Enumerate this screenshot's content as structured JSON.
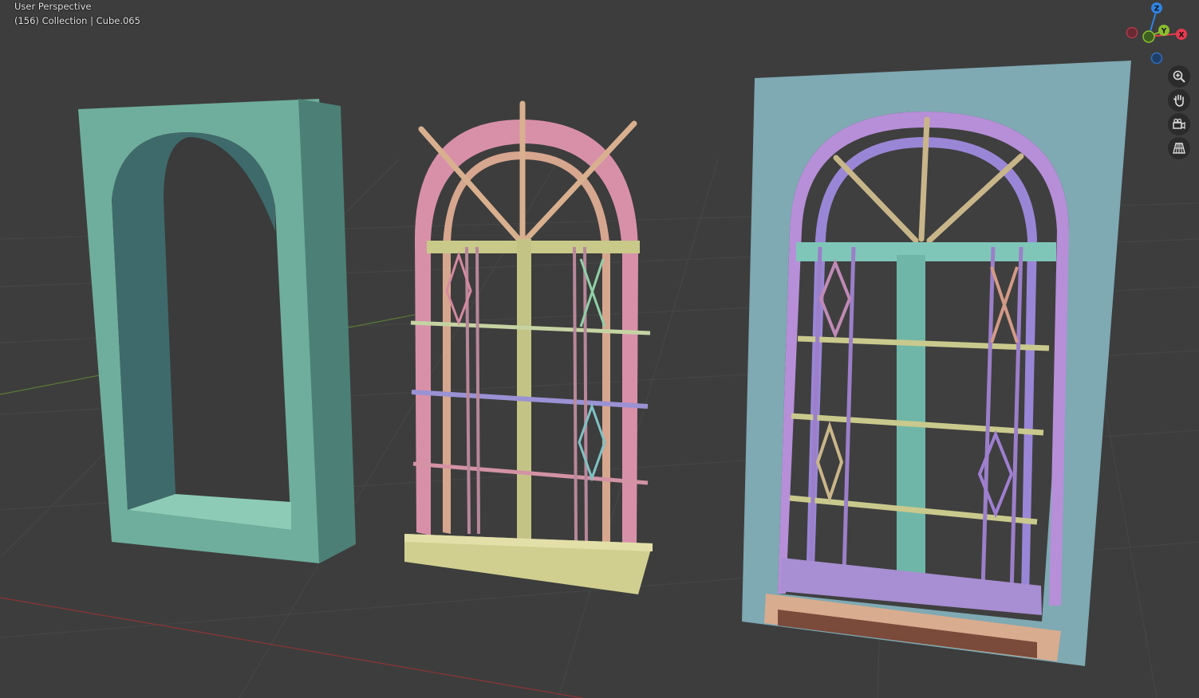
{
  "viewport": {
    "view_name": "User Perspective",
    "object_info": "(156) Collection | Cube.065"
  },
  "gizmo": {
    "axes": [
      {
        "name": "Z",
        "color": "#2f84e3"
      },
      {
        "name": "Y",
        "color": "#8bbe2f"
      },
      {
        "name": "X",
        "color": "#e8384f"
      }
    ]
  },
  "nav_buttons": [
    {
      "name": "zoom-icon"
    },
    {
      "name": "hand-pan-icon"
    },
    {
      "name": "camera-icon"
    },
    {
      "name": "grid-perspective-icon"
    }
  ],
  "colors": {
    "background": "#3d3d3d",
    "grid": "#4a4a4a",
    "x_axis": "#9a3b3b",
    "y_axis": "#6b8a3b",
    "wall_frame": "#6aa696",
    "middle_arch": "#d48aa0",
    "middle_base": "#cccc88",
    "right_panel": "#7faab6",
    "right_arch": "#b48fd6"
  }
}
